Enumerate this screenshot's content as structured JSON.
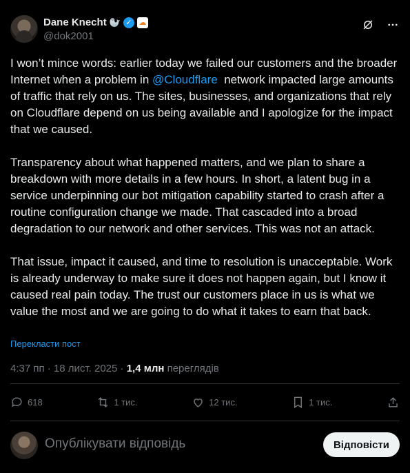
{
  "author": {
    "name": "Dane Knecht",
    "emoji": "🦭",
    "verified_mark": "✓",
    "affiliate_badge": "☁",
    "handle": "@dok2001"
  },
  "header_icons": [
    "grok-icon",
    "more-icon"
  ],
  "tweet": {
    "p1_before": "I won’t mince words: earlier today we failed our customers and the broader Internet when a problem in ",
    "mention": "@Cloudflare",
    "p1_after": "  network impacted large amounts of traffic that rely on us. The sites, businesses, and organizations that rely on Cloudflare depend on us being available and I apologize for the impact that we caused.",
    "p2": "Transparency about what happened matters, and we plan to share a breakdown with more details in a few hours. In short, a latent bug in a service underpinning our bot mitigation capability started to crash after a routine configuration change we made. That cascaded into a broad degradation to our network and other services. This was not an attack.",
    "p3": "That issue, impact it caused, and time to resolution is unacceptable. Work is already underway to make sure it does not happen again, but I know it caused real pain today. The trust our customers place in us is what we value the most and we are going to do what it takes to earn that back."
  },
  "translate_label": "Перекласти пост",
  "meta": {
    "time": "4:37 пп",
    "sep1": " · ",
    "date": "18 лист. 2025",
    "sep2": " · ",
    "views": "1,4 млн",
    "views_label": " переглядів"
  },
  "actions": {
    "replies": "618",
    "reposts": "1 тис.",
    "likes": "12 тис.",
    "bookmarks": "1 тис."
  },
  "reply": {
    "placeholder": "Опублікувати відповідь",
    "button": "Відповісти"
  },
  "colors": {
    "background": "#000000",
    "text": "#e7e9ea",
    "muted": "#71767b",
    "accent": "#1d9bf0"
  }
}
